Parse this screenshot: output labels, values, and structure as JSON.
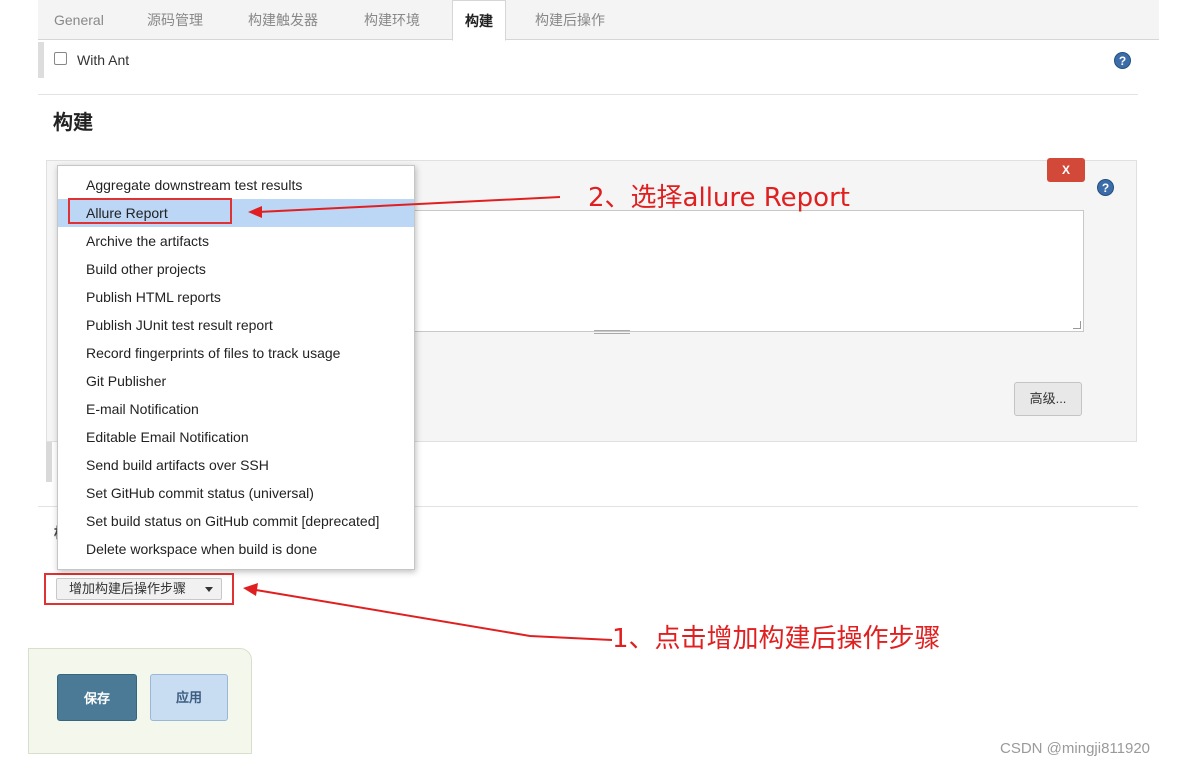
{
  "tabs": [
    {
      "label": "General"
    },
    {
      "label": "源码管理"
    },
    {
      "label": "构建触发器"
    },
    {
      "label": "构建环境"
    },
    {
      "label": "构建"
    },
    {
      "label": "构建后操作"
    }
  ],
  "with_ant": {
    "label": "With Ant",
    "checked": false
  },
  "section": {
    "title": "构建"
  },
  "build_panel": {
    "delete_label": "X",
    "advanced_label": "高级..."
  },
  "postbuild": {
    "title_fragment": "构"
  },
  "dropdown": {
    "selected_index": 1,
    "items": [
      "Aggregate downstream test results",
      "Allure Report",
      "Archive the artifacts",
      "Build other projects",
      "Publish HTML reports",
      "Publish JUnit test result report",
      "Record fingerprints of files to track usage",
      "Git Publisher",
      "E-mail Notification",
      "Editable Email Notification",
      "Send build artifacts over SSH",
      "Set GitHub commit status (universal)",
      "Set build status on GitHub commit [deprecated]",
      "Delete workspace when build is done"
    ]
  },
  "add_step": {
    "label": "增加构建后操作步骤"
  },
  "buttons": {
    "save": "保存",
    "apply": "应用"
  },
  "annotations": {
    "step1": "1、点击增加构建后操作步骤",
    "step2": "2、选择allure Report",
    "color": "#e02020"
  },
  "watermark": "CSDN @mingji811920",
  "icons": {
    "help": "question-circle-icon",
    "dropdown": "caret-down-icon"
  }
}
